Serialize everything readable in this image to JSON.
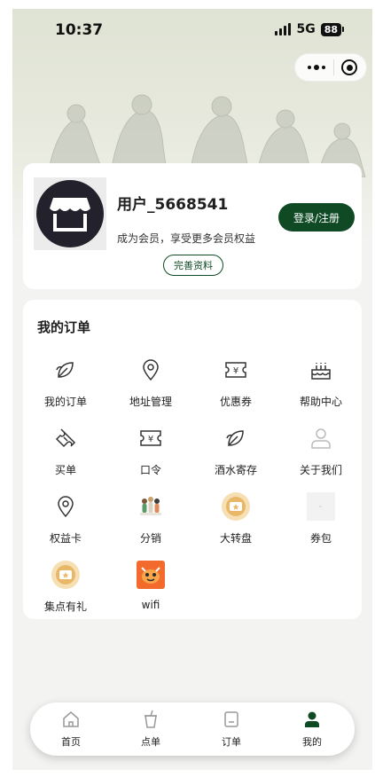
{
  "status_bar": {
    "time": "10:37",
    "network": "5G",
    "battery": "88"
  },
  "profile": {
    "username": "用户_5668541",
    "subtitle": "成为会员，享受更多会员权益",
    "login_label": "登录/注册",
    "complete_label": "完善资料"
  },
  "orders": {
    "title": "我的订单",
    "items": [
      {
        "label": "我的订单",
        "icon": "leaf-icon"
      },
      {
        "label": "地址管理",
        "icon": "location-pin-icon"
      },
      {
        "label": "优惠券",
        "icon": "coupon-icon"
      },
      {
        "label": "帮助中心",
        "icon": "cake-icon"
      },
      {
        "label": "买单",
        "icon": "ticket-icon"
      },
      {
        "label": "口令",
        "icon": "voucher-icon"
      },
      {
        "label": "酒水寄存",
        "icon": "leaf-icon"
      },
      {
        "label": "关于我们",
        "icon": "person-icon"
      },
      {
        "label": "权益卡",
        "icon": "location-pin-icon"
      },
      {
        "label": "分销",
        "icon": "figures-image-icon"
      },
      {
        "label": "大转盘",
        "icon": "gold-ticket-icon"
      },
      {
        "label": "券包",
        "icon": "placeholder-image-icon"
      },
      {
        "label": "集点有礼",
        "icon": "gold-ticket-icon"
      },
      {
        "label": "wifi",
        "icon": "tiger-image-icon"
      }
    ]
  },
  "tabbar": {
    "items": [
      {
        "label": "首页",
        "icon": "home-icon"
      },
      {
        "label": "点单",
        "icon": "cup-icon"
      },
      {
        "label": "订单",
        "icon": "receipt-icon"
      },
      {
        "label": "我的",
        "icon": "user-icon",
        "active": true
      }
    ]
  },
  "colors": {
    "brand": "#0f4a25",
    "background": "#f3f3f1",
    "card": "#ffffff",
    "text": "#222222"
  }
}
